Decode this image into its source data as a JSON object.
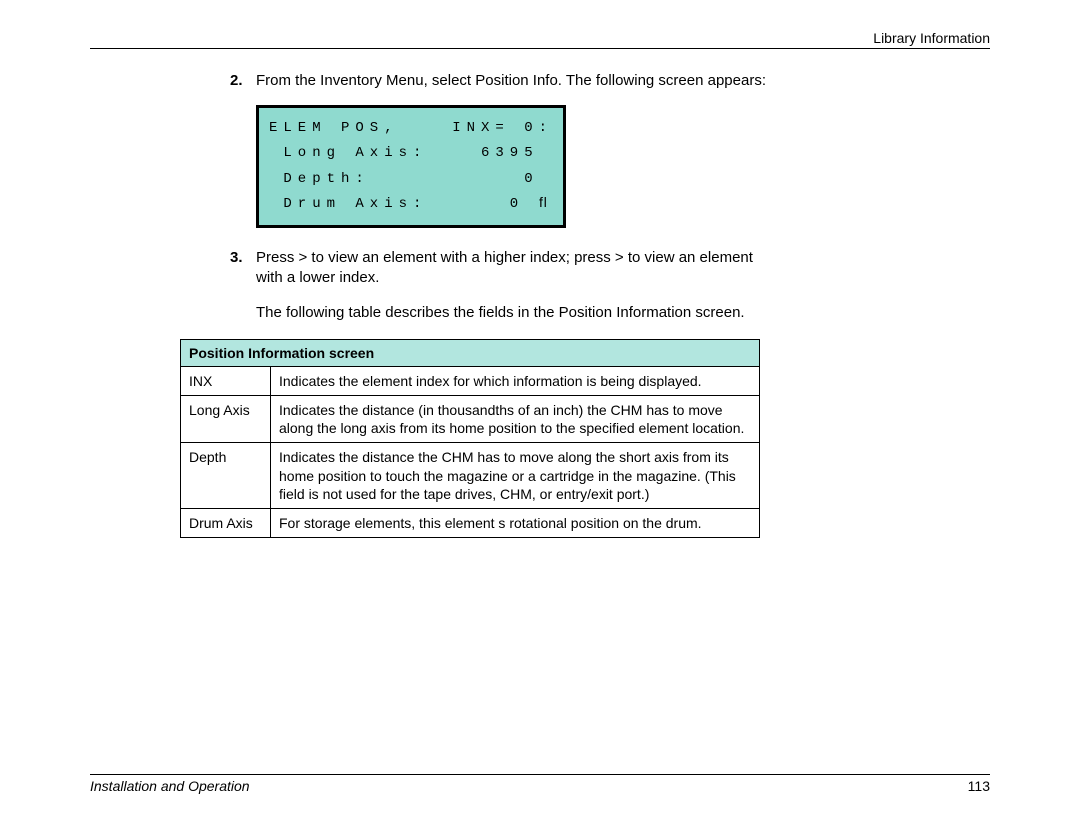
{
  "header": {
    "section": "Library Information"
  },
  "steps": {
    "s2": {
      "num": "2.",
      "text": "From the Inventory Menu, select Position Info. The following screen appears:"
    },
    "s3": {
      "num": "3.",
      "text": "Press > to view an element with a higher index; press > to view an element with a lower index."
    }
  },
  "lcd": {
    "r1l": "ELEM POS,",
    "r1r": "INX= 0:",
    "r2l": " Long Axis:",
    "r2r": "6395 ",
    "r3l": " Depth:",
    "r3r": "0 ",
    "r4l": " Drum Axis:",
    "r4r": "0 ﬂ"
  },
  "para1": "The following table describes the fields in the Position Information screen.",
  "table": {
    "title": "Position Information screen",
    "rows": [
      {
        "field": "INX",
        "desc": "Indicates the element index for which information is being displayed."
      },
      {
        "field": "Long Axis",
        "desc": "Indicates the distance (in thousandths of an inch) the CHM has to move along the long axis from its home position to the specified element location."
      },
      {
        "field": "Depth",
        "desc": "Indicates the distance the CHM has to move along the short axis from its home position to touch the magazine or a cartridge in the magazine. (This field is not used for the tape drives, CHM, or entry/exit port.)"
      },
      {
        "field": "Drum Axis",
        "desc": "For storage elements, this element s rotational position on the drum."
      }
    ]
  },
  "footer": {
    "left": "Installation and Operation",
    "page": "113"
  }
}
